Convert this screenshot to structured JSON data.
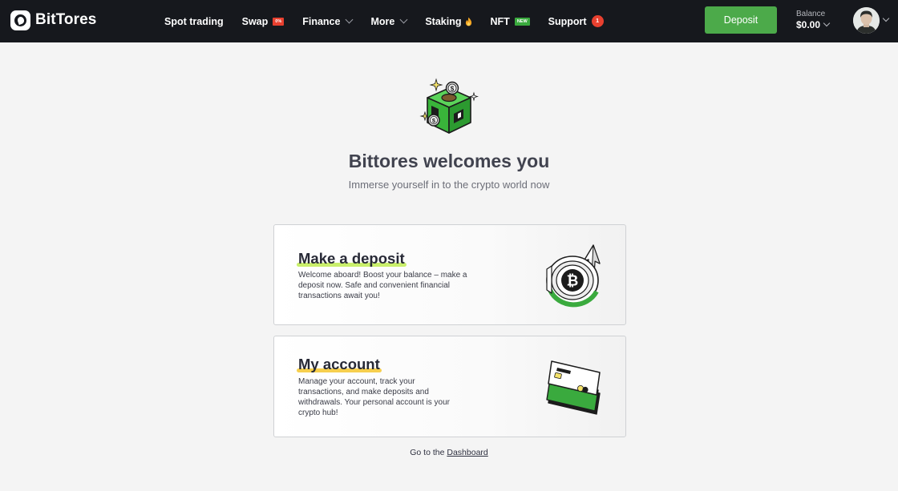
{
  "header": {
    "logo_text": "BitTores",
    "nav": [
      {
        "label": "Spot trading"
      },
      {
        "label": "Swap",
        "badge": "0%"
      },
      {
        "label": "Finance"
      },
      {
        "label": "More"
      },
      {
        "label": "Staking"
      },
      {
        "label": "NFT",
        "badge": "NEW"
      },
      {
        "label": "Support",
        "count": "1"
      }
    ],
    "deposit_label": "Deposit",
    "balance_label": "Balance",
    "balance_value": "$0.00"
  },
  "hero": {
    "title": "Bittores welcomes you",
    "subtitle": "Immerse yourself in to the crypto world now"
  },
  "cards": [
    {
      "title": "Make a deposit",
      "description": "Welcome aboard! Boost your balance – make a deposit now. Safe and convenient financial transactions await you!"
    },
    {
      "title": "My account",
      "description": "Manage your account, track your transactions, and make deposits and withdrawals. Your personal account is your crypto hub!"
    }
  ],
  "footer": {
    "prefix": "Go to the",
    "link": "Dashboard"
  },
  "colors": {
    "header_bg": "#16181d",
    "accent_green": "#4caa4a",
    "badge_red": "#e8402f",
    "badge_green": "#3aaa3e",
    "highlight_lime": "#c9ef6b",
    "highlight_yellow": "#f6cf4e"
  },
  "icons": [
    "logo-icon",
    "chevron-down-icon",
    "fire-icon",
    "avatar-icon",
    "cube-coin-icon",
    "bitcoin-deposit-icon",
    "card-icon"
  ]
}
